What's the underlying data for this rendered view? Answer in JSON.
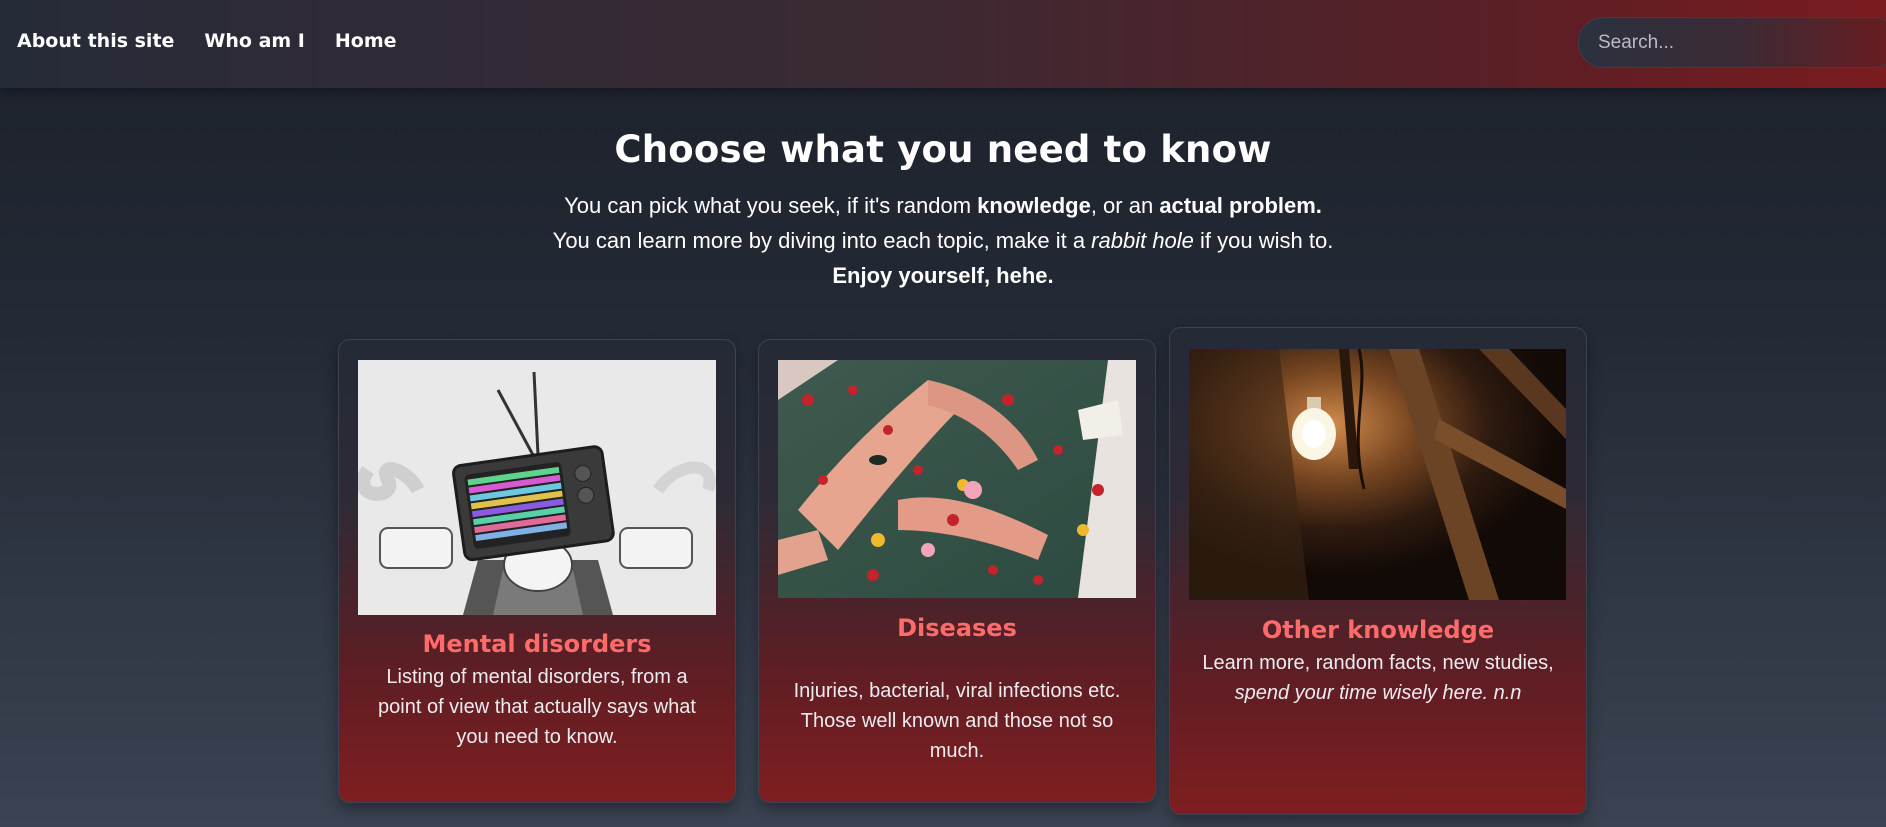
{
  "nav": {
    "links": [
      "About this site",
      "Who am I",
      "Home"
    ],
    "search_placeholder": "Search..."
  },
  "hero": {
    "title": "Choose what you need to know",
    "line1_a": "You can pick what you seek, if it's random ",
    "line1_b": "knowledge",
    "line1_c": ", or an ",
    "line1_d": "actual problem.",
    "line2_a": "You can learn more by diving into each topic, make it a ",
    "line2_b": "rabbit hole",
    "line2_c": " if you wish to.",
    "line3": "Enjoy yourself, hehe."
  },
  "cards": [
    {
      "title": "Mental disorders",
      "desc": "Listing of mental disorders, from a point of view that actually says what you need to know.",
      "image": "tv-head-illustration"
    },
    {
      "title": "Diseases",
      "desc": "Injuries, bacterial, viral infections etc. Those well known and those not so much.",
      "image": "bathtub-flowers-photo"
    },
    {
      "title": "Other knowledge",
      "desc_a": "Learn more, random facts, new studies, ",
      "desc_b": "spend your time wisely here. n.n",
      "image": "lightbulb-attic-photo"
    }
  ],
  "colors": {
    "accent": "#ff6b6b",
    "nav_gradient_end": "#7a1b1f",
    "background": "#1b202a"
  }
}
